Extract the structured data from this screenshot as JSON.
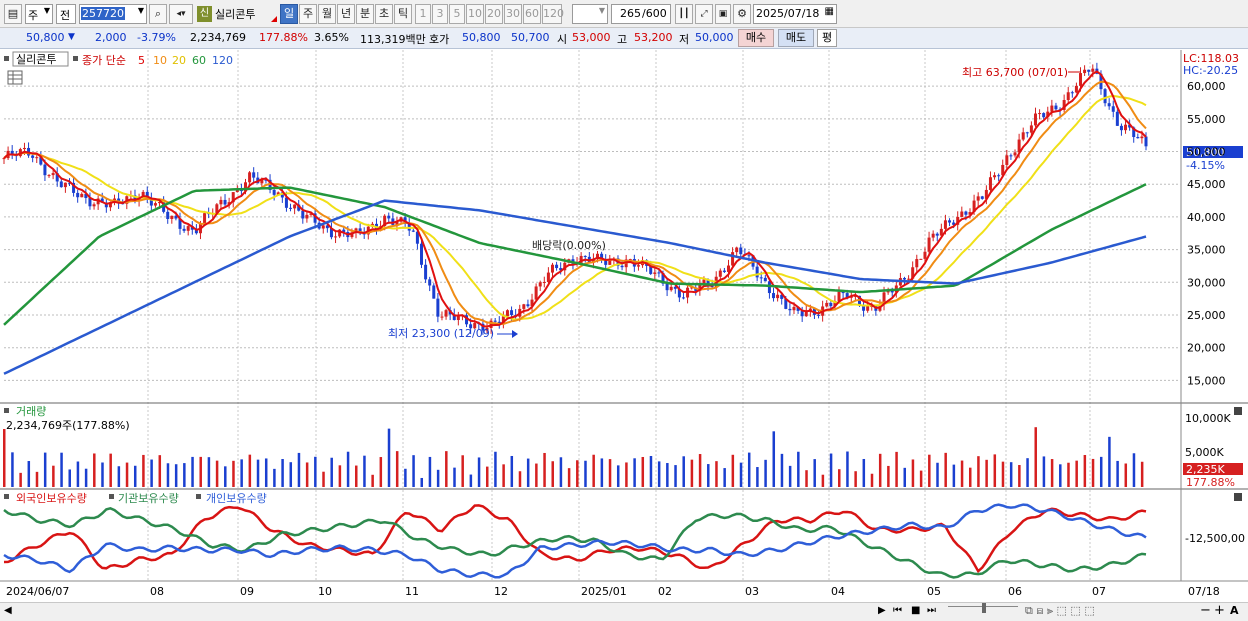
{
  "toolbar": {
    "period_code": "주",
    "prev_label": "전",
    "stock_code": "257720",
    "credit_badge": "신",
    "stock_name": "실리콘투",
    "periods": [
      "일",
      "주",
      "월",
      "년",
      "분",
      "초",
      "틱"
    ],
    "active_period": "일",
    "intervals": [
      "1",
      "3",
      "5",
      "10",
      "20",
      "30",
      "60",
      "120"
    ],
    "count_value": "265",
    "count_total": "/600",
    "date_value": "2025/07/18"
  },
  "quote": {
    "price": "50,800",
    "change": "2,000",
    "change_pct": "-3.79%",
    "volume": "2,234,769",
    "vol_ratio": "177.88%",
    "turnover": "3.65%",
    "amount": "113,319백만",
    "ask_label": "호가",
    "ask": "50,800",
    "bid": "50,700",
    "open_label": "시",
    "open": "53,000",
    "high_label": "고",
    "high": "53,200",
    "low_label": "저",
    "low": "50,000",
    "buy_button": "매수",
    "sell_button": "매도",
    "eval_button": "평"
  },
  "price_panel": {
    "legend_name": "실리콘투",
    "legend_ma_label": "종가 단순",
    "ma_periods": [
      "5",
      "10",
      "20",
      "60",
      "120"
    ],
    "lc_label": "LC:118.03",
    "hc_label": "HC:-20.25",
    "high_annotation": "최고 63,700 (07/01)",
    "low_annotation": "최저 23,300 (12/09)",
    "dividend_annotation": "배당락(0.00%)",
    "last_price_tag": "50,800",
    "last_change_tag": "-4.15%",
    "y_ticks": [
      "60,000",
      "55,000",
      "50,000",
      "45,000",
      "40,000",
      "35,000",
      "30,000",
      "25,000",
      "20,000",
      "15,000"
    ]
  },
  "volume_panel": {
    "title": "거래량",
    "value": "2,234,769주(177.88%)",
    "y_ticks": [
      "10,000K",
      "5,000K"
    ],
    "last_tag": "2,235K",
    "last_pct": "177.88%"
  },
  "holdings_panel": {
    "series_labels": [
      "외국인보유수량",
      "기관보유수량",
      "개인보유수량"
    ],
    "y_tick": "-12,500,00"
  },
  "x_axis": [
    "2024/06/07",
    "08",
    "09",
    "10",
    "11",
    "12",
    "2025/01",
    "02",
    "03",
    "04",
    "05",
    "06",
    "07",
    "07/18"
  ],
  "colors": {
    "up": "#d62020",
    "down": "#1a3fd0",
    "ma5": "#e01010",
    "ma10": "#f08c14",
    "ma20": "#f0e018",
    "ma60": "#23963c",
    "ma120": "#2a5ad0",
    "foreign": "#d81414",
    "institution": "#2d8a4e",
    "individual": "#2f5ed8"
  },
  "chart_data": {
    "type": "line",
    "title": "실리콘투",
    "x": [
      "2024/06/07",
      "08",
      "09",
      "10",
      "11",
      "12",
      "2025/01",
      "02",
      "03",
      "04",
      "05",
      "06",
      "07"
    ],
    "series": [
      {
        "name": "종가",
        "values": [
          49000,
          43000,
          40000,
          45000,
          38000,
          24000,
          33000,
          30000,
          31000,
          27000,
          40000,
          55000,
          56000
        ]
      },
      {
        "name": "60",
        "values": [
          23500,
          37000,
          44000,
          44500,
          41500,
          36000,
          33000,
          29800,
          29500,
          28500,
          29500,
          38000,
          45000
        ]
      },
      {
        "name": "120",
        "values": [
          16000,
          23000,
          30000,
          37000,
          42500,
          41000,
          38500,
          36000,
          33000,
          30500,
          29800,
          33000,
          37000
        ]
      }
    ],
    "high": 63700,
    "low": 23300,
    "last": 50800,
    "ylim": [
      12000,
      64000
    ]
  }
}
